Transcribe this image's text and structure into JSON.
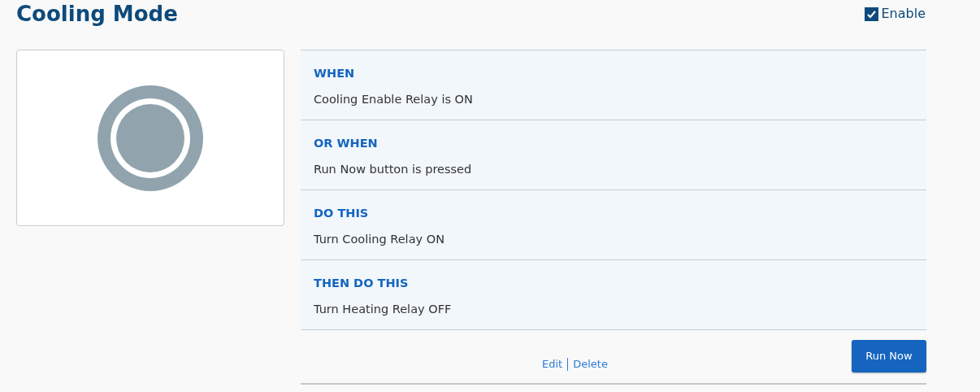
{
  "title": "Cooling Mode",
  "enable": {
    "label": "Enable",
    "checked": true
  },
  "sections": [
    {
      "heading": "WHEN",
      "text": "Cooling Enable Relay is ON"
    },
    {
      "heading": "OR WHEN",
      "text": "Run Now button is pressed"
    },
    {
      "heading": "DO THIS",
      "text": "Turn Cooling Relay ON"
    },
    {
      "heading": "THEN DO THIS",
      "text": "Turn Heating Relay OFF"
    }
  ],
  "links": [
    "Edit",
    "Delete"
  ],
  "button": "Run Now"
}
